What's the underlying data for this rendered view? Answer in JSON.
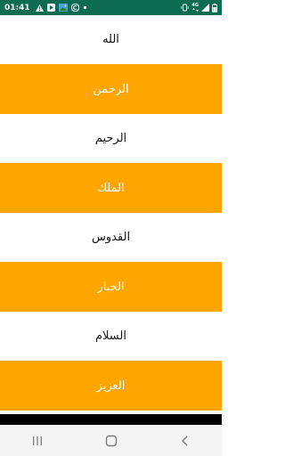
{
  "status_bar": {
    "time": "01:41",
    "network_label": "4G",
    "icons_left": [
      "warning-icon",
      "play-icon",
      "image-icon",
      "c-icon",
      "dot-icon"
    ],
    "icons_right": [
      "vibrate-icon",
      "network-icon",
      "signal-icon",
      "battery-icon"
    ]
  },
  "names": [
    {
      "label": "الله",
      "style": "white"
    },
    {
      "label": "الرحمن",
      "style": "orange"
    },
    {
      "label": "الرحيم",
      "style": "white"
    },
    {
      "label": "الملك",
      "style": "orange"
    },
    {
      "label": "القدوس",
      "style": "white"
    },
    {
      "label": "الجبار",
      "style": "orange"
    },
    {
      "label": "السلام",
      "style": "white"
    },
    {
      "label": "العزيز",
      "style": "orange"
    }
  ],
  "colors": {
    "status_bar": "#0d6b52",
    "accent": "#ffa500",
    "item_text_on_white": "#111111",
    "item_text_on_orange": "#ffffff"
  },
  "nav_bar": {
    "buttons": [
      "recents-icon",
      "home-icon",
      "back-icon"
    ]
  }
}
